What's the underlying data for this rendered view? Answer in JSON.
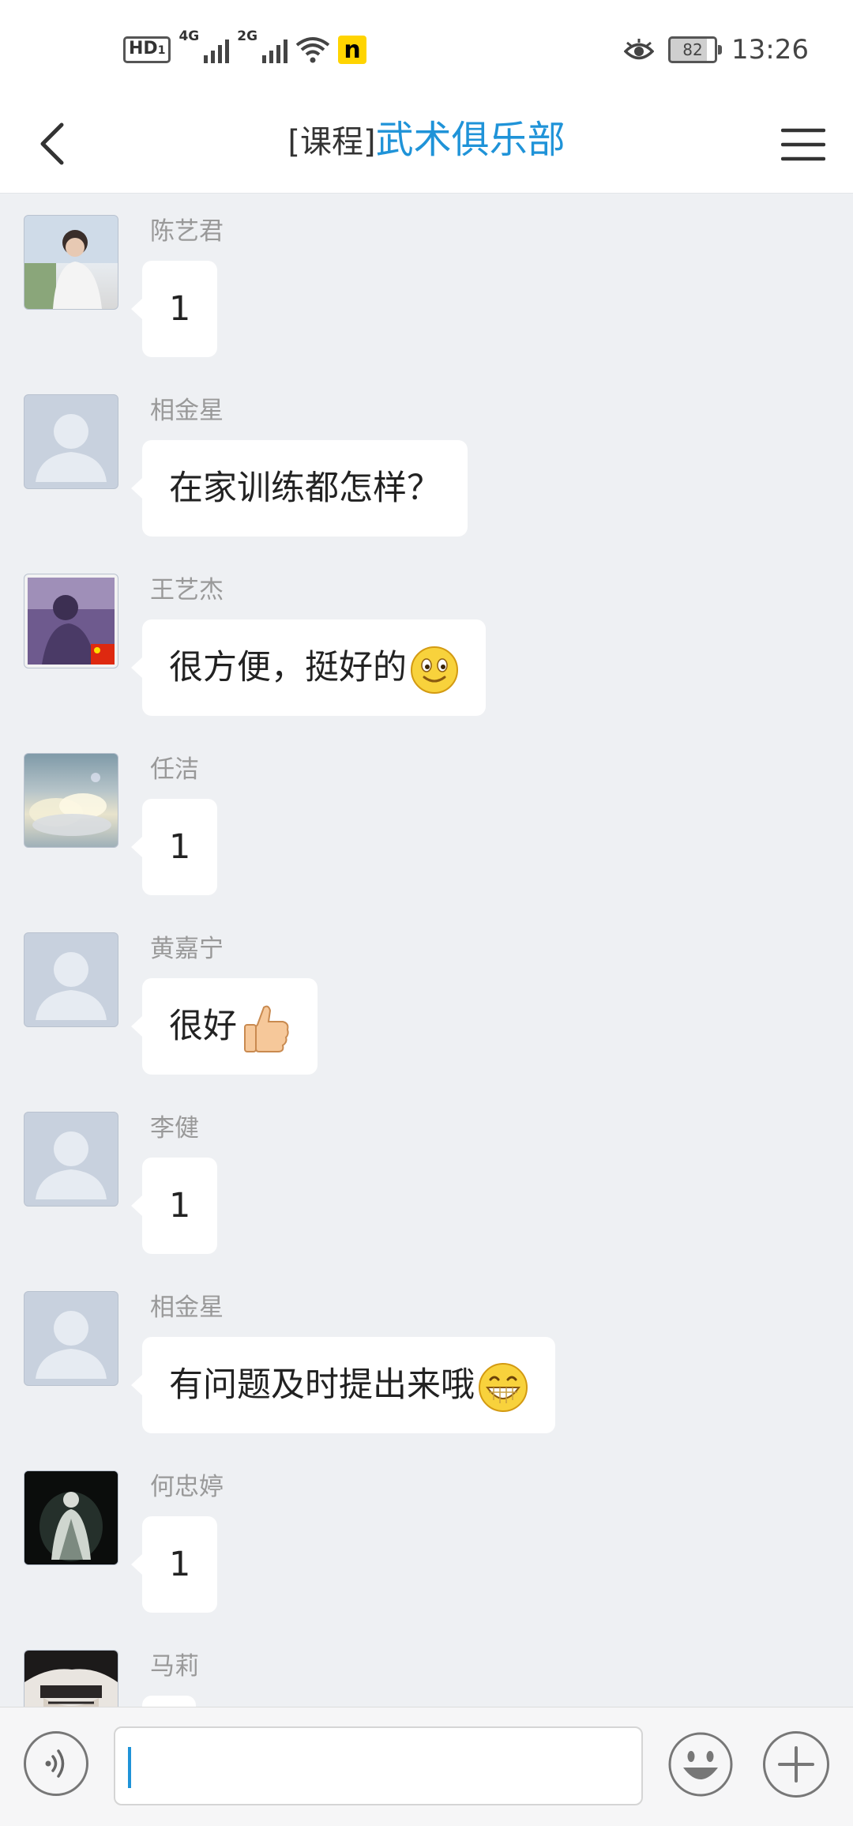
{
  "status_bar": {
    "hd": "HD",
    "hd_sub": "1",
    "net1": "4G",
    "net2": "2G",
    "n_badge": "n",
    "battery": "82",
    "time": "13:26"
  },
  "header": {
    "prefix": "[课程]",
    "name": "武术俱乐部"
  },
  "messages": [
    {
      "sender": "陈艺君",
      "text": "1",
      "avatar": "photo-boy"
    },
    {
      "sender": "相金星",
      "text": "在家训练都怎样？",
      "avatar": "default-person"
    },
    {
      "sender": "王艺杰",
      "text": "很方便，挺好的",
      "emoji": "smile-emoji",
      "avatar": "photo-purple"
    },
    {
      "sender": "任洁",
      "text": "1",
      "avatar": "photo-clouds"
    },
    {
      "sender": "黄嘉宁",
      "text": "很好",
      "emoji": "thumbs-up-emoji",
      "avatar": "default-person"
    },
    {
      "sender": "李健",
      "text": "1",
      "avatar": "default-person"
    },
    {
      "sender": "相金星",
      "text": "有问题及时提出来哦",
      "emoji": "grin-emoji",
      "avatar": "default-person"
    },
    {
      "sender": "何忠婷",
      "text": "1",
      "avatar": "photo-dark"
    },
    {
      "sender": "马莉",
      "text": "",
      "avatar": "photo-anime"
    }
  ],
  "input": {
    "value": ""
  },
  "icons": {
    "back": "back-arrow-icon",
    "menu": "menu-icon",
    "voice": "voice-icon",
    "emoji": "emoji-icon",
    "plus": "plus-icon"
  },
  "colors": {
    "accent": "#1f93d8",
    "background": "#eef0f3"
  }
}
